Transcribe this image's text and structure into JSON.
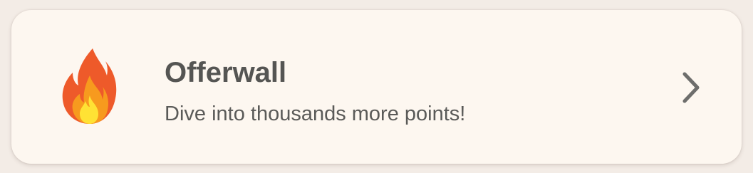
{
  "offerwall_card": {
    "title": "Offerwall",
    "subtitle": "Dive into thousands more points!",
    "icon": "fire-icon",
    "trailing_icon": "chevron-right-icon"
  },
  "colors": {
    "page_background": "#f3ece6",
    "card_background": "#fdf7f0",
    "text_primary": "#555553",
    "chevron": "#6e6e6c"
  }
}
